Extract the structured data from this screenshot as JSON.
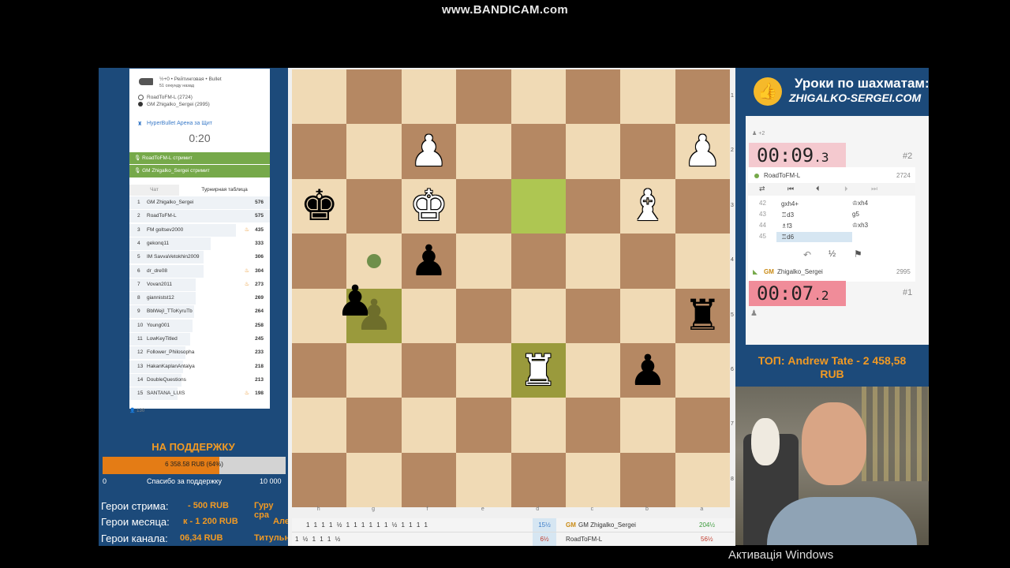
{
  "watermark": "www.BANDICAM.com",
  "game_info": {
    "mode": "½+0 • Рейтинговая • Bullet",
    "time_ago": "51 секунду назад",
    "white_player": "RoadToFM-L (2724)",
    "black_player": "GM Zhigalko_Sergei (2995)",
    "tournament": "HyperBullet Арена за Щит",
    "tournament_timer": "0:20"
  },
  "streamers": [
    "RoadToFM-L стримит",
    "GM Zhigalko_Sergei стримит"
  ],
  "tabs": {
    "chat": "Чат",
    "standings": "Турнирная таблица"
  },
  "standings": [
    {
      "rank": "1",
      "name": "GM Zhigalko_Sergei",
      "pts": "576",
      "fire": false,
      "bar": 1.0
    },
    {
      "rank": "2",
      "name": "RoadToFM-L",
      "pts": "575",
      "fire": false,
      "bar": 1.0
    },
    {
      "rank": "3",
      "name": "FM goltsev2000",
      "pts": "435",
      "fire": true,
      "bar": 0.76
    },
    {
      "rank": "4",
      "name": "gekonq11",
      "pts": "333",
      "fire": false,
      "bar": 0.58
    },
    {
      "rank": "5",
      "name": "IM SavvaVetokhin2009",
      "pts": "306",
      "fire": false,
      "bar": 0.53
    },
    {
      "rank": "6",
      "name": "dr_dre08",
      "pts": "304",
      "fire": true,
      "bar": 0.53
    },
    {
      "rank": "7",
      "name": "Vovan2011",
      "pts": "273",
      "fire": true,
      "bar": 0.47
    },
    {
      "rank": "8",
      "name": "giannistst12",
      "pts": "269",
      "fire": false,
      "bar": 0.47
    },
    {
      "rank": "9",
      "name": "BblWejI_TToKyruTb",
      "pts": "264",
      "fire": false,
      "bar": 0.46
    },
    {
      "rank": "10",
      "name": "Young001",
      "pts": "258",
      "fire": false,
      "bar": 0.45
    },
    {
      "rank": "11",
      "name": "LowKeyTitled",
      "pts": "245",
      "fire": false,
      "bar": 0.43
    },
    {
      "rank": "12",
      "name": "Follower_Philosopha",
      "pts": "233",
      "fire": false,
      "bar": 0.4
    },
    {
      "rank": "13",
      "name": "HakanKaplanAntalya",
      "pts": "218",
      "fire": false,
      "bar": 0.38
    },
    {
      "rank": "14",
      "name": "DoubleQuestions",
      "pts": "213",
      "fire": false,
      "bar": 0.37
    },
    {
      "rank": "15",
      "name": "SANTANA_LUIS",
      "pts": "198",
      "fire": true,
      "bar": 0.34
    }
  ],
  "player_count": "130",
  "support": {
    "title": "НА ПОДДЕРЖКУ",
    "progress_text": "6 358.58 RUB (64%)",
    "progress": 0.64,
    "min": "0",
    "thanks": "Спасибо за поддержку",
    "max": "10 000"
  },
  "heroes": [
    {
      "label": "Герои стрима:",
      "value": "- 500 RUB",
      "extra": "Гуру сра"
    },
    {
      "label": "Герои месяца:",
      "value": "к - 1 200 RUB",
      "extra": "Але"
    },
    {
      "label": "Герои канала:",
      "value": "06,34 RUB",
      "extra": "Титульн"
    }
  ],
  "board": {
    "files": [
      "h",
      "g",
      "f",
      "e",
      "d",
      "c",
      "b",
      "a"
    ],
    "ranks": [
      "1",
      "2",
      "3",
      "4",
      "5",
      "6",
      "7",
      "8"
    ],
    "pieces": [
      {
        "sq": "1-2",
        "glyph": "♟",
        "color": "w"
      },
      {
        "sq": "1-7",
        "glyph": "♟",
        "color": "w"
      },
      {
        "sq": "2-0",
        "glyph": "♚",
        "color": "b"
      },
      {
        "sq": "2-2",
        "glyph": "♚",
        "color": "w"
      },
      {
        "sq": "2-6",
        "glyph": "♝",
        "color": "w"
      },
      {
        "sq": "3-2",
        "glyph": "♟",
        "color": "b"
      },
      {
        "sq": "4-1",
        "glyph": "♟",
        "color": "b"
      },
      {
        "sq": "4-7",
        "glyph": "♜",
        "color": "b"
      },
      {
        "sq": "5-4",
        "glyph": "♜",
        "color": "w"
      },
      {
        "sq": "5-6",
        "glyph": "♟",
        "color": "b"
      }
    ]
  },
  "crosstable": {
    "row1_scores": "1 1 1 1 ½ 1   1 1 1   1 1 ½ 1 1 1 1",
    "row1_total": "15½",
    "row1_player": "GM Zhigalko_Sergei",
    "row1_match": "204½",
    "row2_scores": "1       ½   1 1   1   ½",
    "row2_total": "6½",
    "row2_player": "RoadToFM-L",
    "row2_match": "56½"
  },
  "promo": {
    "line1": "Уроки по шахматам:",
    "line2": "ZHIGALKO-SERGEI.COM"
  },
  "clocks": {
    "top": {
      "main": "00:09",
      "tenths": ".3",
      "rank": "#2",
      "diff": "+2"
    },
    "bottom": {
      "main": "00:07",
      "tenths": ".2",
      "rank": "#1"
    }
  },
  "players": {
    "top": {
      "name": "RoadToFM-L",
      "rating": "2724"
    },
    "bottom": {
      "title": "GM",
      "name": "Zhigalko_Sergei",
      "rating": "2995"
    }
  },
  "moves": [
    {
      "no": "42",
      "white": "gxh4+",
      "black": "♔xh4"
    },
    {
      "no": "43",
      "white": "♖d3",
      "black": "g5"
    },
    {
      "no": "44",
      "white": "♗f3",
      "black": "♔xh3"
    },
    {
      "no": "45",
      "white": "♖d6",
      "black": ""
    }
  ],
  "draw_label": "½",
  "top_donor": {
    "line1": "ТОП: Andrew Tate - 2 458,58",
    "line2": "RUB"
  },
  "activate": "Активація Windows"
}
